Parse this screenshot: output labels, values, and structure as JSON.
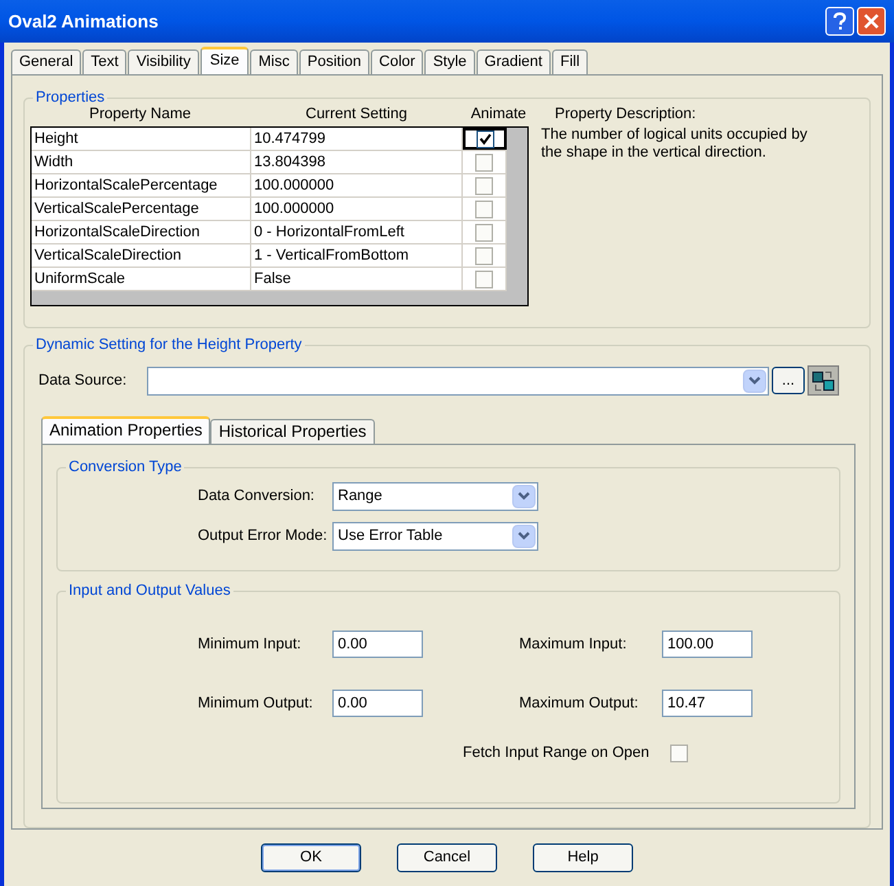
{
  "window": {
    "title": "Oval2 Animations"
  },
  "tabs": [
    {
      "label": "General",
      "selected": false
    },
    {
      "label": "Text",
      "selected": false
    },
    {
      "label": "Visibility",
      "selected": false
    },
    {
      "label": "Size",
      "selected": true
    },
    {
      "label": "Misc",
      "selected": false
    },
    {
      "label": "Position",
      "selected": false
    },
    {
      "label": "Color",
      "selected": false
    },
    {
      "label": "Style",
      "selected": false
    },
    {
      "label": "Gradient",
      "selected": false
    },
    {
      "label": "Fill",
      "selected": false
    }
  ],
  "properties": {
    "title": "Properties",
    "columns": [
      "Property Name",
      "Current Setting",
      "Animate"
    ],
    "description_label": "Property Description:",
    "description": "The number of logical units occupied by the shape in the vertical direction.",
    "rows": [
      {
        "name": "Height",
        "value": "10.474799",
        "animate": true,
        "selected": true
      },
      {
        "name": "Width",
        "value": "13.804398",
        "animate": false,
        "selected": false
      },
      {
        "name": "HorizontalScalePercentage",
        "value": "100.000000",
        "animate": false,
        "selected": false
      },
      {
        "name": "VerticalScalePercentage",
        "value": "100.000000",
        "animate": false,
        "selected": false
      },
      {
        "name": "HorizontalScaleDirection",
        "value": "0 - HorizontalFromLeft",
        "animate": false,
        "selected": false
      },
      {
        "name": "VerticalScaleDirection",
        "value": "1 - VerticalFromBottom",
        "animate": false,
        "selected": false
      },
      {
        "name": "UniformScale",
        "value": "False",
        "animate": false,
        "selected": false
      }
    ]
  },
  "dynamic": {
    "title": "Dynamic Setting for the Height Property",
    "data_source_label": "Data Source:",
    "browse_button": "...",
    "tabs": [
      {
        "label": "Animation Properties",
        "selected": true
      },
      {
        "label": "Historical Properties",
        "selected": false
      }
    ],
    "conversion": {
      "title": "Conversion Type",
      "fields": [
        {
          "label": "Data Conversion:",
          "value": "Range"
        },
        {
          "label": "Output Error Mode:",
          "value": "Use Error Table"
        }
      ]
    },
    "io": {
      "title": "Input and Output Values",
      "fields": [
        {
          "label": "Minimum Input:",
          "value": "0.00"
        },
        {
          "label": "Maximum Input:",
          "value": "100.00"
        },
        {
          "label": "Minimum Output:",
          "value": "0.00"
        },
        {
          "label": "Maximum Output:",
          "value": "10.47"
        }
      ],
      "fetch": {
        "label": "Fetch Input Range on Open",
        "checked": false
      }
    }
  },
  "buttons": [
    "OK",
    "Cancel",
    "Help"
  ]
}
